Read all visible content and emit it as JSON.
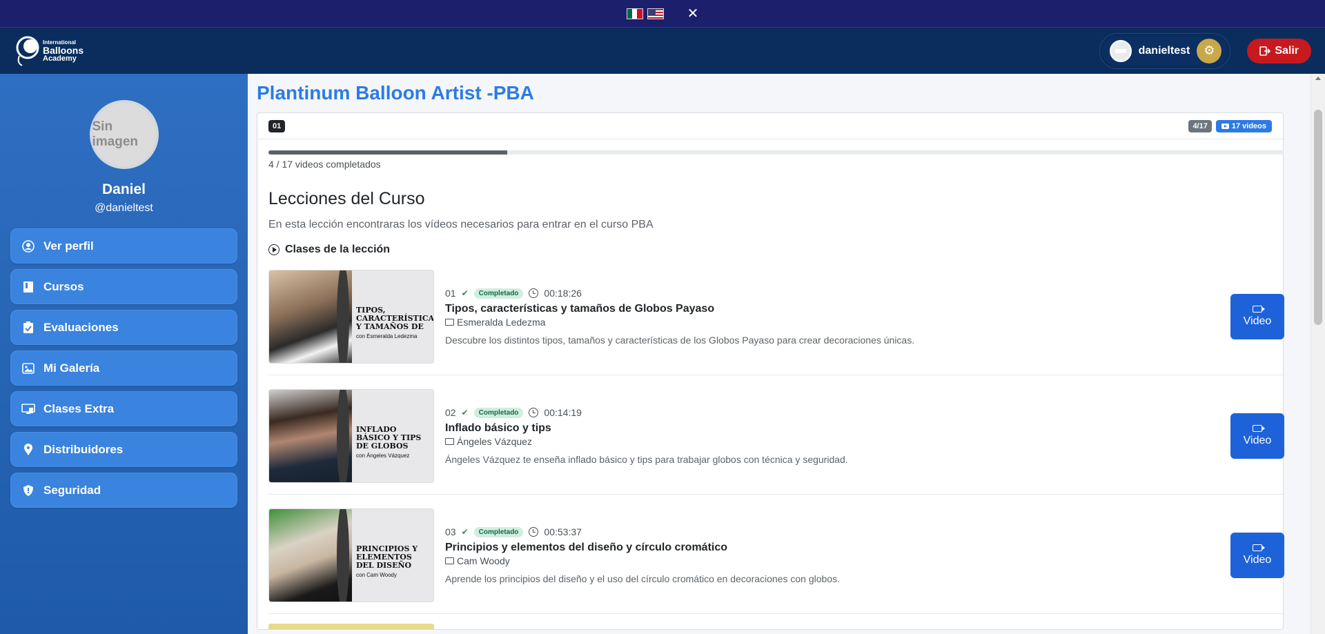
{
  "langbar": {
    "flags": [
      "mexico-flag",
      "usa-flag"
    ],
    "close_symbol": "✕"
  },
  "header": {
    "logo_line1": "International",
    "logo_line2": "Balloons",
    "logo_line3": "Academy",
    "username": "danieltest",
    "logout_label": "Salir"
  },
  "sidebar": {
    "avatar_placeholder": "Sin imagen",
    "name": "Daniel",
    "handle": "@danieltest",
    "items": [
      {
        "label": "Ver perfil",
        "icon": "user-circle-icon"
      },
      {
        "label": "Cursos",
        "icon": "book-icon"
      },
      {
        "label": "Evaluaciones",
        "icon": "clipboard-icon"
      },
      {
        "label": "Mi Galería",
        "icon": "images-icon"
      },
      {
        "label": "Clases Extra",
        "icon": "display-icon"
      },
      {
        "label": "Distribuidores",
        "icon": "map-pin-icon"
      },
      {
        "label": "Seguridad",
        "icon": "shield-icon"
      }
    ]
  },
  "main": {
    "course_title": "Plantinum Balloon Artist -PBA",
    "module_number": "01",
    "progress_badge": "4/17",
    "videos_badge": "17 videos",
    "progress_fraction": 0.235,
    "progress_text": "4 / 17 videos completados",
    "lessons_title": "Lecciones del Curso",
    "lessons_desc": "En esta lección encontraras los vídeos necesarios para entrar en el curso PBA",
    "section_label": "Clases de la lección",
    "lessons": [
      {
        "number": "01",
        "status": "Completado",
        "duration": "00:18:26",
        "title": "Tipos, características y tamaños de Globos Payaso",
        "instructor": "Esmeralda Ledezma",
        "description": "Descubre los distintos tipos, tamaños y características de los Globos Payaso para crear decoraciones únicas.",
        "thumb_title": "TIPOS, CARACTERÍSTICAS Y TAMAÑOS DE",
        "thumb_sub": "con Esmeralda Ledezma",
        "video_label": "Video"
      },
      {
        "number": "02",
        "status": "Completado",
        "duration": "00:14:19",
        "title": "Inflado básico y tips",
        "instructor": "Ángeles Vázquez",
        "description": "Ángeles Vázquez te enseña inflado básico y tips para trabajar globos con técnica y seguridad.",
        "thumb_title": "INFLADO BÁSICO Y TIPS DE GLOBOS",
        "thumb_sub": "con Ángeles Vázquez",
        "video_label": "Video"
      },
      {
        "number": "03",
        "status": "Completado",
        "duration": "00:53:37",
        "title": "Principios y elementos del diseño y círculo cromático",
        "instructor": "Cam Woody",
        "description": "Aprende los principios del diseño y el uso del círculo cromático en decoraciones con globos.",
        "thumb_title": "PRINCIPIOS Y ELEMENTOS DEL DISEÑO",
        "thumb_sub": "con Cam Woody",
        "video_label": "Video"
      }
    ]
  },
  "colors": {
    "langbar_bg": "#1c1f6b",
    "header_bg": "#0a2d5e",
    "sidebar_bg": "#2f6fc2",
    "accent": "#2c7be5",
    "logout": "#c8191f",
    "video_button": "#1d62d9",
    "status_badge": "#d1ede0"
  }
}
